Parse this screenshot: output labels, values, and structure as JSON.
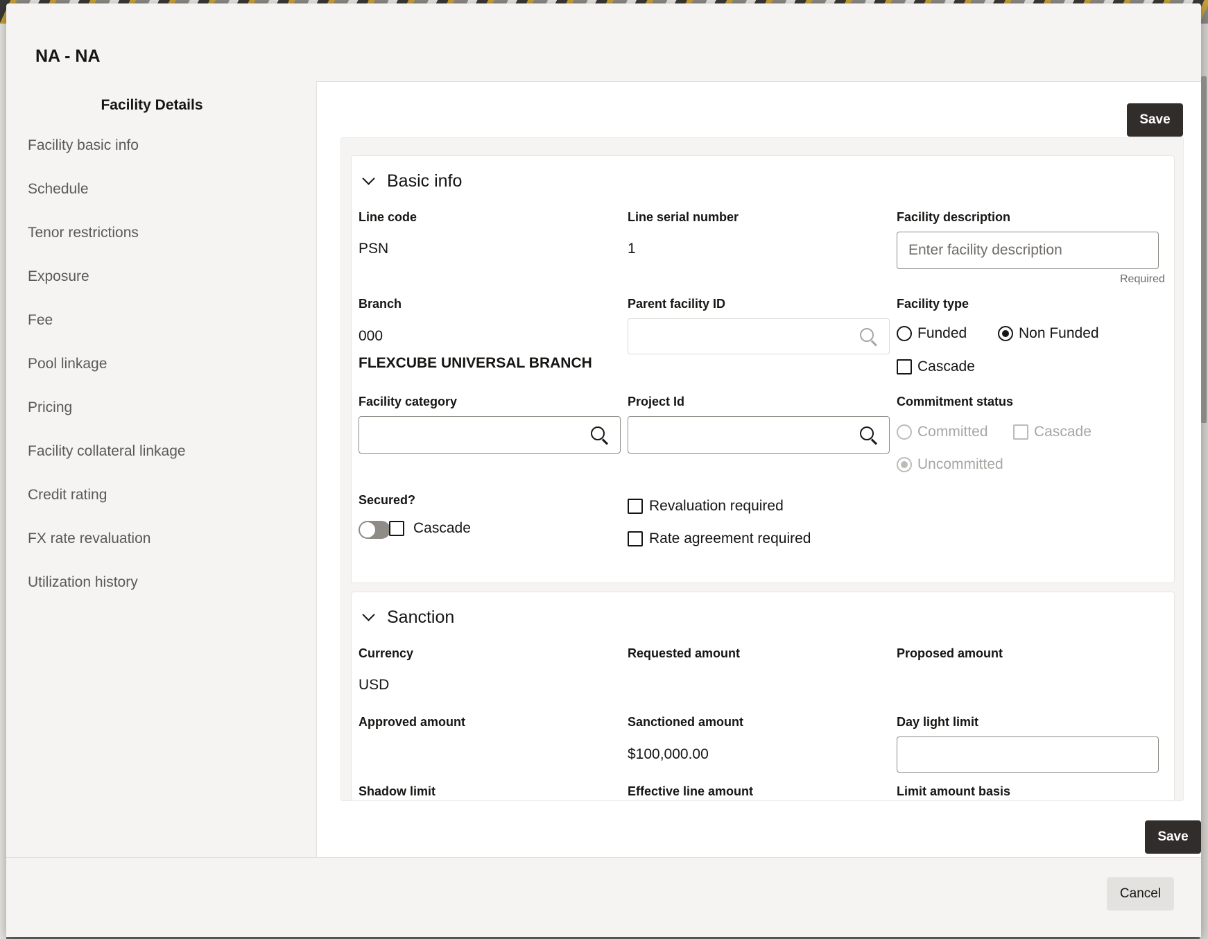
{
  "dialog": {
    "title": "NA - NA"
  },
  "sidebar": {
    "title": "Facility Details",
    "items": [
      {
        "label": "Facility basic info"
      },
      {
        "label": "Schedule"
      },
      {
        "label": "Tenor restrictions"
      },
      {
        "label": "Exposure"
      },
      {
        "label": "Fee"
      },
      {
        "label": "Pool linkage"
      },
      {
        "label": "Pricing"
      },
      {
        "label": "Facility collateral linkage"
      },
      {
        "label": "Credit rating"
      },
      {
        "label": "FX rate revaluation"
      },
      {
        "label": "Utilization history"
      }
    ]
  },
  "actions": {
    "save_label": "Save",
    "cancel_label": "Cancel"
  },
  "basic_info": {
    "title": "Basic info",
    "line_code": {
      "label": "Line code",
      "value": "PSN"
    },
    "line_serial_number": {
      "label": "Line serial number",
      "value": "1"
    },
    "facility_description": {
      "label": "Facility description",
      "placeholder": "Enter facility description",
      "helper": "Required",
      "value": ""
    },
    "branch": {
      "label": "Branch",
      "code": "000",
      "name": "FLEXCUBE UNIVERSAL BRANCH"
    },
    "parent_facility_id": {
      "label": "Parent facility ID",
      "value": ""
    },
    "facility_type": {
      "label": "Facility type",
      "options": [
        "Funded",
        "Non Funded"
      ],
      "selected": "Non Funded",
      "cascade_label": "Cascade"
    },
    "facility_category": {
      "label": "Facility category",
      "value": ""
    },
    "project_id": {
      "label": "Project Id",
      "value": ""
    },
    "commitment_status": {
      "label": "Commitment status",
      "options": [
        "Committed",
        "Uncommitted"
      ],
      "selected": "Uncommitted",
      "cascade_label": "Cascade"
    },
    "secured": {
      "label": "Secured?",
      "on": false,
      "cascade_label": "Cascade"
    },
    "revaluation_required": {
      "label": "Revaluation required",
      "checked": false
    },
    "rate_agreement_required": {
      "label": "Rate agreement required",
      "checked": false
    }
  },
  "sanction": {
    "title": "Sanction",
    "currency": {
      "label": "Currency",
      "value": "USD"
    },
    "requested_amount": {
      "label": "Requested amount",
      "value": ""
    },
    "proposed_amount": {
      "label": "Proposed amount",
      "value": ""
    },
    "approved_amount": {
      "label": "Approved amount",
      "value": ""
    },
    "sanctioned_amount": {
      "label": "Sanctioned amount",
      "value": "$100,000.00"
    },
    "day_light_limit": {
      "label": "Day light limit",
      "value": ""
    },
    "shadow_limit": {
      "label": "Shadow limit"
    },
    "effective_line_amount": {
      "label": "Effective line amount"
    },
    "limit_amount_basis": {
      "label": "Limit amount basis"
    }
  }
}
